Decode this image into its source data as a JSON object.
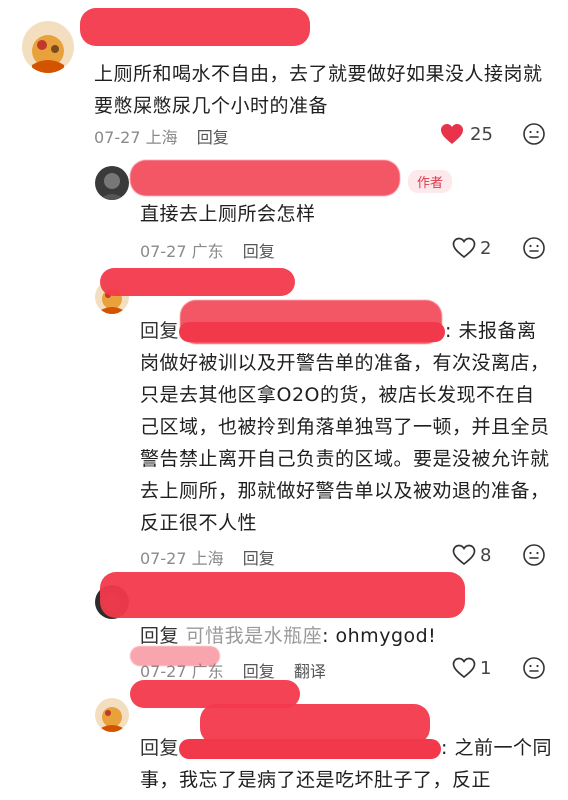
{
  "comments": [
    {
      "text": "上厕所和喝水不自由，去了就要做好如果没人接岗就要憋屎憋尿几个小时的准备",
      "date": "07-27",
      "location": "上海",
      "reply_label": "回复",
      "likes": "25",
      "liked": true
    },
    {
      "author_tag": "作者",
      "text": "直接去上厕所会怎样",
      "date": "07-27",
      "location": "广东",
      "reply_label": "回复",
      "likes": "2"
    },
    {
      "prefix": "回复",
      "text_after": ": 未报备离岗做好被训以及开警告单的准备，有次没离店，只是去其他区拿O2O的货，被店长发现不在自己区域，也被拎到角落单独骂了一顿，并且全员警告禁止离开自己负责的区域。要是没被允许就去上厕所，那就做好警告单以及被劝退的准备，反正很不人性",
      "date": "07-27",
      "location": "上海",
      "reply_label": "回复",
      "likes": "8"
    },
    {
      "prefix": "回复",
      "reply_to": "可惜我是水瓶座",
      "text_after": ": ohmygod!",
      "date": "07-27",
      "location": "广东",
      "reply_label": "回复",
      "translate_label": "翻译",
      "likes": "1"
    },
    {
      "prefix": "回复",
      "text_after": ": 之前一个同事，我忘了是病了还是吃坏肚子了，反正"
    }
  ],
  "colors": {
    "redaction": "#f2394b",
    "like_active": "#e8334a",
    "meta_gray": "#8a8a8a"
  },
  "icons": [
    "heart-icon",
    "comment-emoji-icon"
  ]
}
